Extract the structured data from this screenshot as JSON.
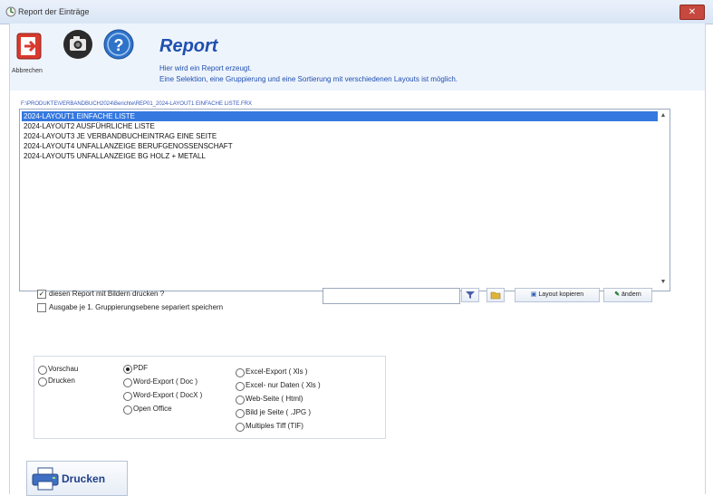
{
  "window": {
    "title": "Report der Einträge",
    "close_label": "✕"
  },
  "toolbar": {
    "cancel_label": "Abbrechen"
  },
  "header": {
    "title": "Report",
    "line1": "Hier wird ein Report erzeugt.",
    "line2": "Eine Selektion, eine Gruppierung und eine Sortierung mit verschiedenen Layouts ist möglich."
  },
  "path": "F:\\PRODUKTE\\VERBANDBUCH2024\\Berichte\\REP01_2024-LAYOUT1 EINFACHE LISTE.FRX",
  "layouts": [
    "2024-LAYOUT1 EINFACHE LISTE",
    "2024-LAYOUT2 AUSFÜHRLICHE LISTE",
    "2024-LAYOUT3  JE VERBANDBUCHEINTRAG EINE SEITE",
    "2024-LAYOUT4  UNFALLANZEIGE BERUFGENOSSENSCHAFT",
    "2024-LAYOUT5  UNFALLANZEIGE BG HOLZ + METALL"
  ],
  "options": {
    "with_images_label": "diesen Report mit Bildern drucken ?",
    "with_images_checked": true,
    "separate_label": "Ausgabe je 1. Gruppierungsebene separiert speichern",
    "separate_checked": false
  },
  "filter": {
    "value": "",
    "copy_label": "Layout kopieren",
    "edit_label": "ändern"
  },
  "output": {
    "col1": [
      "Vorschau",
      "Drucken"
    ],
    "col2": [
      "PDF",
      "Word-Export ( Doc )",
      "Word-Export  ( DocX )",
      "Open Office"
    ],
    "col3": [
      "Excel-Export ( Xls )",
      "Excel- nur Daten ( Xls )",
      "Web-Seite ( Html)",
      "Bild je Seite ( .JPG )",
      "Multiples Tiff  (TIF)"
    ],
    "selected": "PDF"
  },
  "print_button": {
    "label": "Drucken"
  },
  "colors": {
    "accent": "#1f4fb0",
    "selection": "#3478e0",
    "close": "#c7483e"
  }
}
